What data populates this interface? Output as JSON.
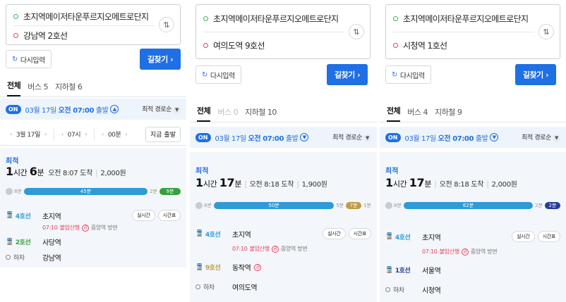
{
  "colors": {
    "accent": "#1f6fe5",
    "line4": "#2e9bd6",
    "line2": "#33a23d",
    "line9": "#bd9b47",
    "line1": "#263c96",
    "start_dot": "#3cb45a",
    "end_dot": "#e8405a"
  },
  "panels": [
    {
      "origin": "초지역메이저타운푸르지오메트로단지",
      "destination": "강남역 2호선",
      "reset_label": "다시입력",
      "go_label": "길찾기",
      "tabs": [
        {
          "label": "전체"
        },
        {
          "label": "버스 5"
        },
        {
          "label": "지하철 6"
        }
      ],
      "departure": {
        "on": "ON",
        "date": "03월 17일",
        "time": "오전 07:00",
        "suffix": "출발"
      },
      "sort_label": "최적 경로순",
      "time_picker": {
        "date": "3월 17일",
        "hour": "07시",
        "minute": "00분",
        "now_label": "지금 출발"
      },
      "result": {
        "badge": "최적",
        "hours": "1",
        "hours_unit": "시간",
        "minutes": "6",
        "minutes_unit": "분",
        "arrival": "오전 8:07 도착",
        "fare": "2,000원",
        "segments": {
          "walk_start": "8분",
          "ride_main": "45분",
          "walk_mid": "2분",
          "ride_end": "9분"
        },
        "steps": [
          {
            "line": "4호선",
            "station": "초지역",
            "train_time": "07:10",
            "train_dest": "불암산행",
            "direction": "중앙역 방면",
            "btn1": "실시간",
            "btn2": "시간표"
          },
          {
            "line": "2호선",
            "station": "사당역"
          },
          {
            "line": "하차",
            "station": "강남역"
          }
        ]
      }
    },
    {
      "origin": "초지역메이저타운푸르지오메트로단지",
      "destination": "여의도역 9호선",
      "reset_label": "다시입력",
      "go_label": "길찾기",
      "tabs": [
        {
          "label": "전체"
        },
        {
          "label": "버스 0"
        },
        {
          "label": "지하철 10"
        }
      ],
      "departure": {
        "on": "ON",
        "date": "03월 17일",
        "time": "오전 07:00",
        "suffix": "출발"
      },
      "sort_label": "최적 경로순",
      "result": {
        "badge": "최적",
        "hours": "1",
        "hours_unit": "시간",
        "minutes": "17",
        "minutes_unit": "분",
        "arrival": "오전 8:18 도착",
        "fare": "1,900원",
        "segments": {
          "walk_start": "8분",
          "ride_main": "50분",
          "walk_mid": "5분",
          "ride_end": "7분",
          "walk_end": "1분"
        },
        "steps": [
          {
            "line": "4호선",
            "station": "초지역",
            "train_time": "07:10",
            "train_dest": "불암산행",
            "direction": "중앙역 방면",
            "btn1": "실시간",
            "btn2": "시간표"
          },
          {
            "line": "9호선",
            "station": "동작역"
          },
          {
            "line": "하차",
            "station": "여의도역"
          }
        ]
      }
    },
    {
      "origin": "초지역메이저타운푸르지오메트로단지",
      "destination": "시청역 1호선",
      "reset_label": "다시입력",
      "go_label": "길찾기",
      "tabs": [
        {
          "label": "전체"
        },
        {
          "label": "버스 4"
        },
        {
          "label": "지하철 9"
        }
      ],
      "departure": {
        "on": "ON",
        "date": "03월 17일",
        "time": "오전 07:00",
        "suffix": "출발"
      },
      "sort_label": "최적 경로순",
      "result": {
        "badge": "최적",
        "hours": "1",
        "hours_unit": "시간",
        "minutes": "17",
        "minutes_unit": "분",
        "arrival": "오전 8:18 도착",
        "fare": "2,000원",
        "segments": {
          "walk_start": "8분",
          "ride_main": "62분",
          "walk_mid": "2분",
          "ride_end": "2분"
        },
        "steps": [
          {
            "line": "4호선",
            "station": "초지역",
            "train_time": "07:10",
            "train_dest": "불암산행",
            "direction": "중앙역 방면",
            "btn1": "실시간",
            "btn2": "시간표"
          },
          {
            "line": "1호선",
            "station": "서울역"
          },
          {
            "line": "하차",
            "station": "시청역"
          }
        ]
      }
    }
  ]
}
